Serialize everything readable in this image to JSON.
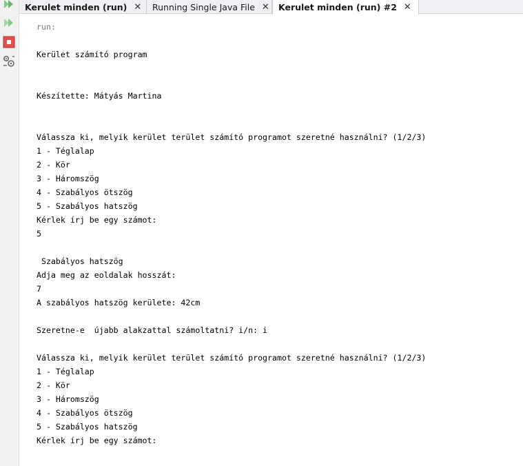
{
  "tabs": [
    {
      "label": "Kerulet minden (run)",
      "bold": true,
      "active": false
    },
    {
      "label": "Running Single Java File",
      "bold": false,
      "active": false
    },
    {
      "label": "Kerulet minden (run) #2",
      "bold": true,
      "active": true
    }
  ],
  "close_glyph": "✕",
  "toolbar": {
    "icons": [
      "rerun-icon",
      "rerun-all-icon",
      "stop-icon",
      "settings-icon"
    ]
  },
  "console": {
    "lines": [
      "run:",
      "",
      "Kerület számító program",
      "",
      "",
      "Készítette: Mátyás Martina",
      "",
      "",
      "Válassza ki, melyik kerület terület számító programot szeretné használni? (1/2/3)",
      "1 - Téglalap",
      "2 - Kör",
      "3 - Háromszög",
      "4 - Szabályos ötszög",
      "5 - Szabályos hatszög",
      "Kérlek írj be egy számot:",
      "5",
      "",
      " Szabályos hatszög",
      "Adja meg az eoldalak hosszát:",
      "7",
      "A szabályos hatszög kerülete: 42cm",
      "",
      "Szeretne-e  újabb alakzattal számoltatni? i/n: i",
      "",
      "Válassza ki, melyik kerület terület számító programot szeretné használni? (1/2/3)",
      "1 - Téglalap",
      "2 - Kör",
      "3 - Háromszög",
      "4 - Szabályos ötszög",
      "5 - Szabályos hatszög",
      "Kérlek írj be egy számot:"
    ]
  }
}
